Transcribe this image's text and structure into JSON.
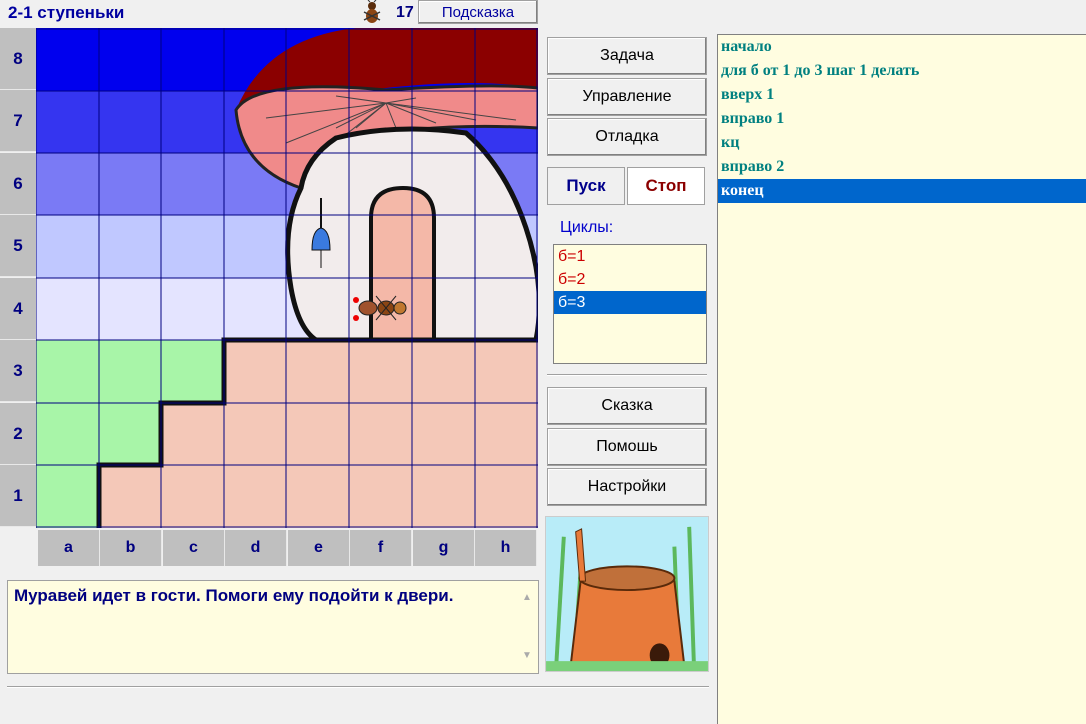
{
  "header": {
    "title": "2-1 ступеньки",
    "ant_count": "17",
    "hint_label": "Подсказка"
  },
  "board": {
    "rows": [
      "8",
      "7",
      "6",
      "5",
      "4",
      "3",
      "2",
      "1"
    ],
    "cols": [
      "a",
      "b",
      "c",
      "d",
      "e",
      "f",
      "g",
      "h"
    ]
  },
  "message": "Муравей идет в гости. Помоги ему подойти к двери.",
  "buttons": {
    "task": "Задача",
    "control": "Управление",
    "debug": "Отладка",
    "run": "Пуск",
    "stop": "Стоп",
    "tale": "Сказка",
    "help": "Помошь",
    "settings": "Настройки"
  },
  "cycles": {
    "label": "Циклы:",
    "items": [
      "б=1",
      "б=2",
      "б=3"
    ],
    "selected_index": 2
  },
  "program": {
    "lines": [
      "начало",
      "для б от 1 до 3 шаг 1 делать",
      "вверх 1",
      "вправо 1",
      "кц",
      "вправо 2",
      "конец"
    ],
    "selected_index": 6
  },
  "colors": {
    "sky_dark": "#0000ff",
    "sky_light": "#e6e6ff",
    "grass": "#a8f5a8",
    "ground": "#f4c8b8",
    "grid": "#000080",
    "selection": "#0066cc"
  }
}
